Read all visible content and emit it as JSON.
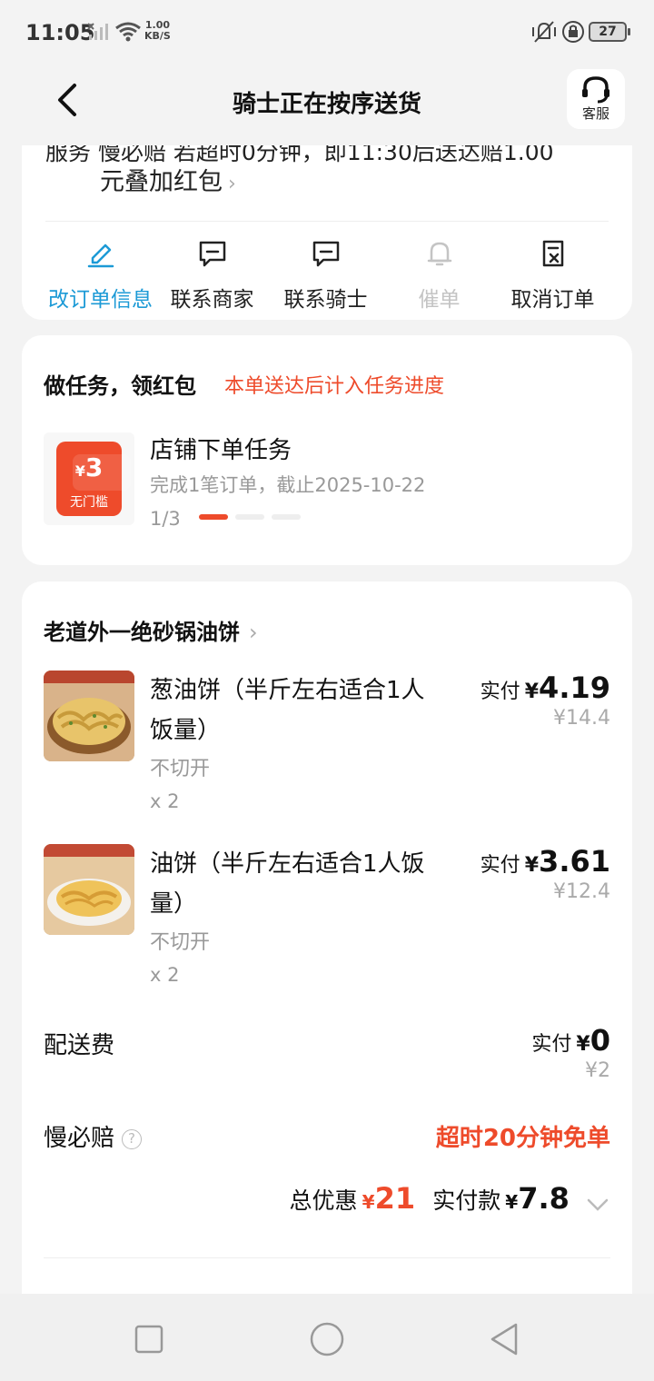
{
  "status_bar": {
    "time": "11:05",
    "speed_top": "1.00",
    "speed_bottom": "KB/S",
    "battery": "27"
  },
  "header": {
    "title": "骑士正在按序送货",
    "service_label": "客服"
  },
  "service_card": {
    "cut_line": "服务 慢必赔 若超时0分钟，即11:30后送达赔1.00",
    "line2": "元叠加红包",
    "actions": [
      {
        "label": "改订单信息",
        "icon": "edit-icon",
        "state": "active"
      },
      {
        "label": "联系商家",
        "icon": "chat-icon",
        "state": "normal"
      },
      {
        "label": "联系骑士",
        "icon": "chat-icon",
        "state": "normal"
      },
      {
        "label": "催单",
        "icon": "bell-icon",
        "state": "disabled"
      },
      {
        "label": "取消订单",
        "icon": "cancel-doc-icon",
        "state": "normal"
      }
    ]
  },
  "task_card": {
    "title": "做任务，领红包",
    "hint": "本单送达后计入任务进度",
    "coupon_currency": "¥",
    "coupon_amount": "3",
    "coupon_label": "无门槛",
    "task_name": "店铺下单任务",
    "task_desc": "完成1笔订单，截止2025-10-22",
    "progress_text": "1/3",
    "progress_done": 1,
    "progress_total": 3
  },
  "order_card": {
    "shop_name": "老道外一绝砂锅油饼",
    "items": [
      {
        "name": "葱油饼（半斤左右适合1人饭量）",
        "option": "不切开",
        "qty": "x 2",
        "paid_label": "实付",
        "currency": "¥",
        "paid": "4.19",
        "original": "¥14.4"
      },
      {
        "name": "油饼（半斤左右适合1人饭量）",
        "option": "不切开",
        "qty": "x 2",
        "paid_label": "实付",
        "currency": "¥",
        "paid": "3.61",
        "original": "¥12.4"
      }
    ],
    "delivery_fee": {
      "label": "配送费",
      "paid_label": "实付",
      "currency": "¥",
      "paid": "0",
      "original": "¥2"
    },
    "slow_guarantee": {
      "label": "慢必赔",
      "value": "超时20分钟免单"
    },
    "total": {
      "discount_label": "总优惠",
      "currency": "¥",
      "discount": "21",
      "paid_label": "实付款",
      "paid": "7.8"
    }
  },
  "colors": {
    "accent": "#1c9ad6",
    "red": "#ee4b2b",
    "background": "#f3f3f3"
  }
}
